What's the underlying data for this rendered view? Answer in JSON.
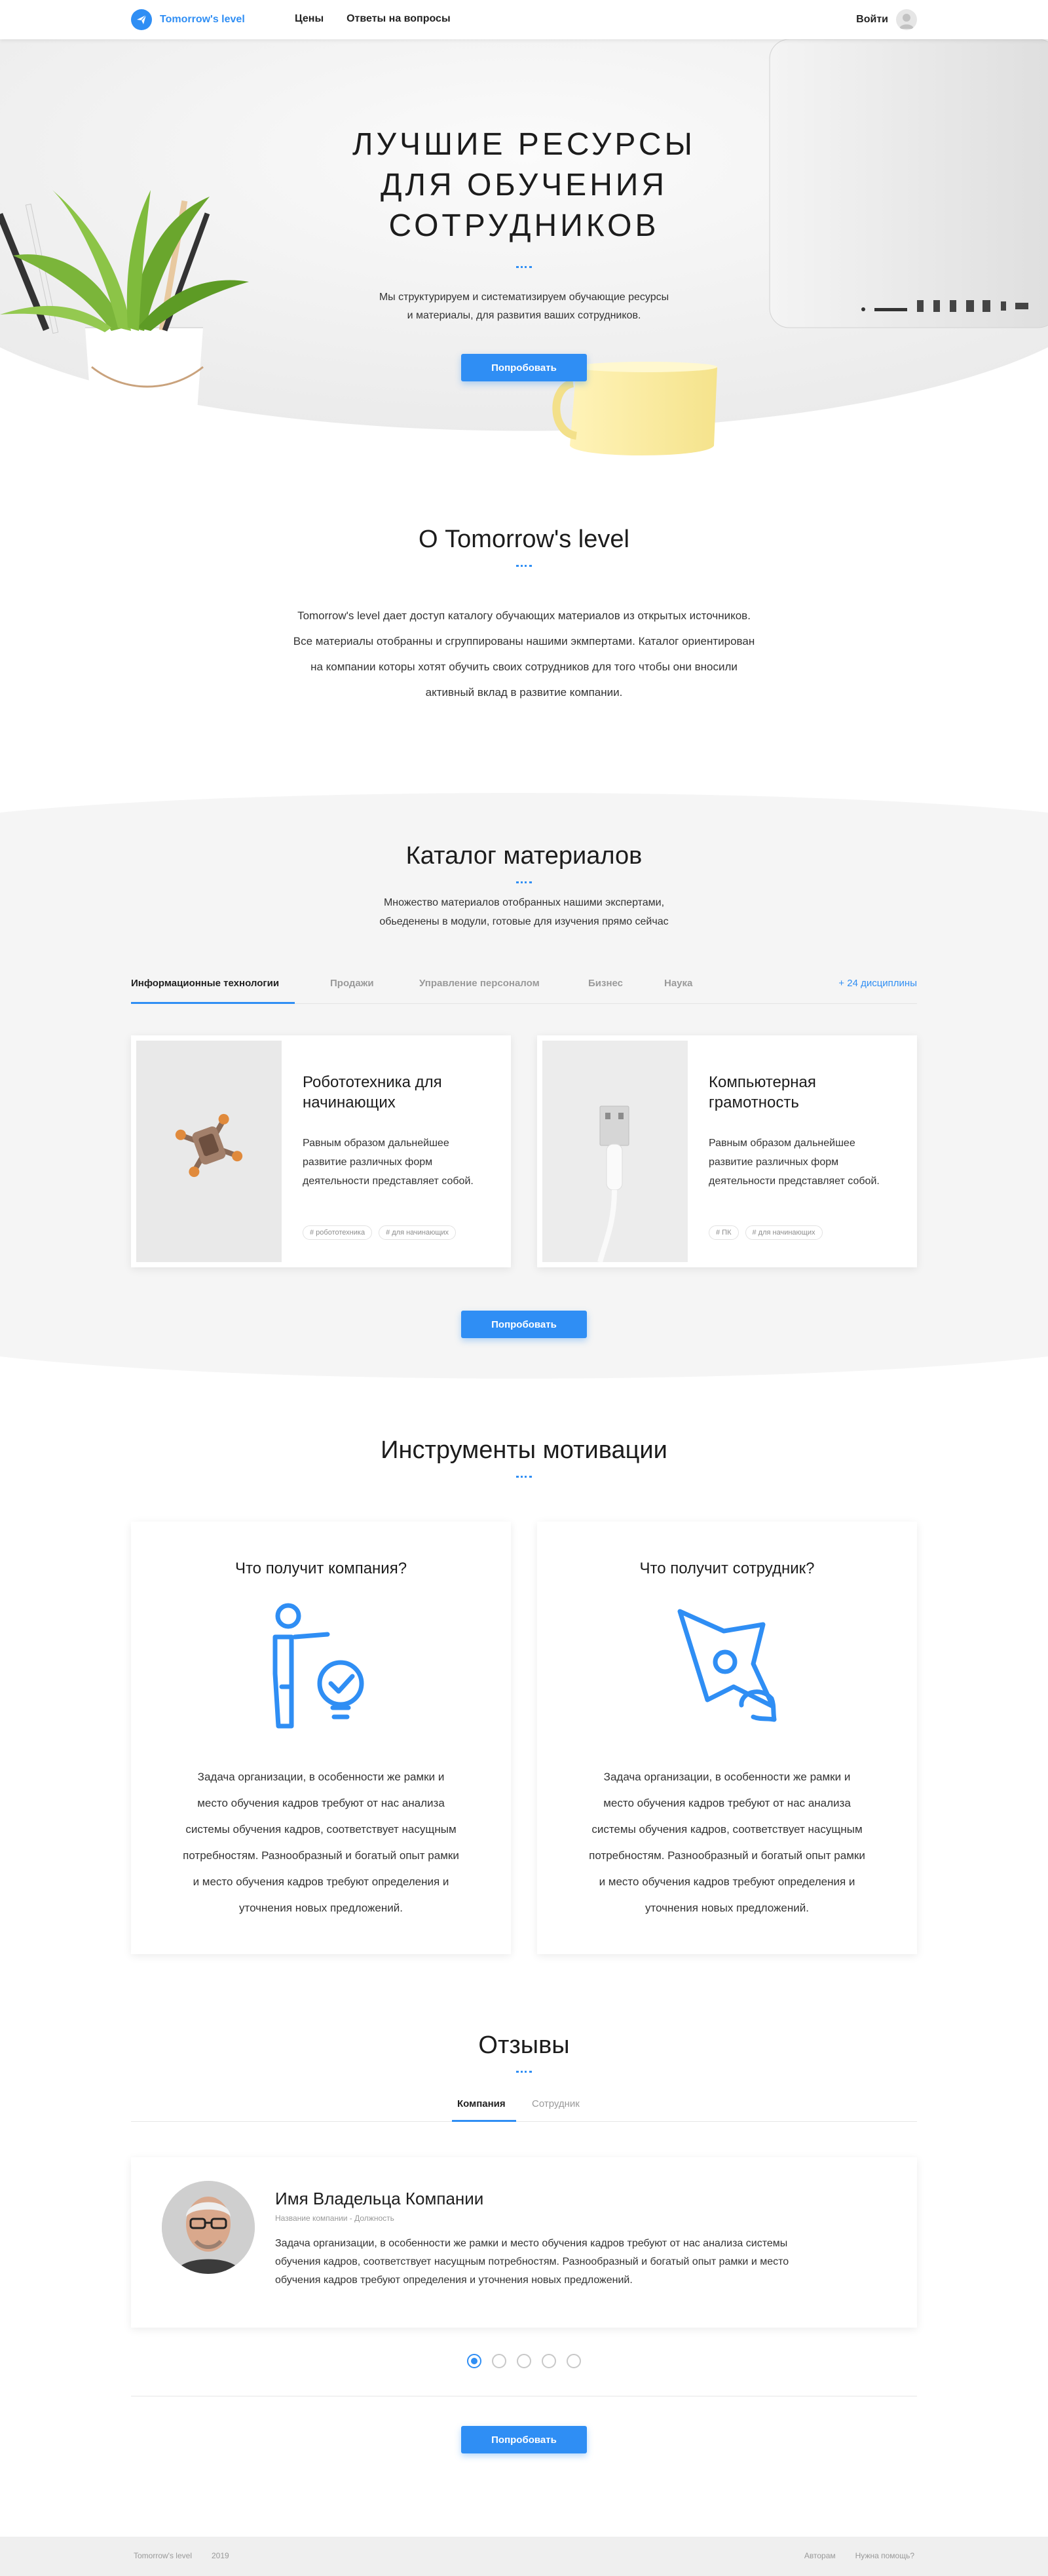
{
  "header": {
    "logo_text": "Tomorrow's level",
    "nav": [
      "Цены",
      "Ответы на вопросы"
    ],
    "login_label": "Войти"
  },
  "hero": {
    "title_lines": [
      "ЛУЧШИЕ РЕСУРСЫ",
      "ДЛЯ ОБУЧЕНИЯ",
      "СОТРУДНИКОВ"
    ],
    "subtitle_lines": [
      "Мы структурируем и систематизируем обучающие ресурсы",
      "и материалы, для развития ваших сотрудников."
    ],
    "button_label": "Попробовать"
  },
  "about": {
    "title": "О Tomorrow's level",
    "text_lines": [
      "Tomorrow's level дает доступ каталогу обучающих материалов из открытых источников.",
      "Все материалы отобранны и сгруппированы нашими экмпертами. Каталог ориентирован",
      "на компании которы хотят обучить своих сотрудников для того чтобы они вносили",
      "активный вклад в развитие компании."
    ]
  },
  "catalog": {
    "title": "Каталог материалов",
    "subtitle_lines": [
      "Множество материалов отобранных нашими экспертами,",
      "обьеденены в модули, готовые для изучения прямо сейчас"
    ],
    "tabs": [
      "Информационные технологии",
      "Продажи",
      "Управление персоналом",
      "Бизнес",
      "Наука"
    ],
    "active_tab": "Информационные технологии",
    "more_label": "+ 24 дисциплины",
    "cards": [
      {
        "title_lines": [
          "Робототехника для",
          "начинающих"
        ],
        "text_lines": [
          "Равным образом дальнейшее",
          "развитие различных форм",
          "деятельности представляет собой."
        ],
        "tags": [
          "# робототехника",
          "# для начинающих"
        ]
      },
      {
        "title_lines": [
          "Компьютерная",
          "грамотность"
        ],
        "text_lines": [
          "Равным образом дальнейшее",
          "развитие различных форм",
          "деятельности представляет собой."
        ],
        "tags": [
          "# ПК",
          "# для начинающих"
        ]
      }
    ],
    "button_label": "Попробовать"
  },
  "motivation": {
    "title": "Инструменты мотивации",
    "cards": [
      {
        "heading": "Что получит компания?",
        "icon": "person-idea-icon",
        "text_lines": [
          "Задача организации, в особенности же рамки и",
          "место обучения кадров требуют от нас анализа",
          "системы обучения кадров, соответствует насущным",
          "потребностям. Разнообразный и богатый опыт рамки",
          "и место обучения кадров требуют определения и",
          "уточнения новых предложений."
        ]
      },
      {
        "heading": "Что получит сотрудник?",
        "icon": "rocket-icon",
        "text_lines": [
          "Задача организации, в особенности же рамки и",
          "место обучения кадров требуют от нас анализа",
          "системы обучения кадров, соответствует насущным",
          "потребностям. Разнообразный и богатый опыт рамки",
          "и место обучения кадров требуют определения и",
          "уточнения новых предложений."
        ]
      }
    ]
  },
  "reviews": {
    "title": "Отзывы",
    "tabs": [
      "Компания",
      "Сотрудник"
    ],
    "active_tab": "Компания",
    "review": {
      "name": "Имя Владельца Компании",
      "role": "Название компании - Должность",
      "text_lines": [
        "Задача организации, в особенности же рамки и место обучения кадров требуют от нас анализа системы",
        "обучения кадров, соответствует насущным потребностям. Разнообразный и богатый опыт рамки и место",
        "обучения кадров требуют определения и уточнения новых предложений."
      ]
    },
    "slides_total": 5,
    "active_slide": 1,
    "button_label": "Попробовать"
  },
  "footer": {
    "brand": "Tomorrow's level",
    "year": "2019",
    "links": [
      "Авторам",
      "Нужна помощь?"
    ]
  },
  "colors": {
    "accent": "#2f8ef4",
    "text": "#222222",
    "muted": "#9a9a9a",
    "section_bg": "#f5f5f5"
  }
}
